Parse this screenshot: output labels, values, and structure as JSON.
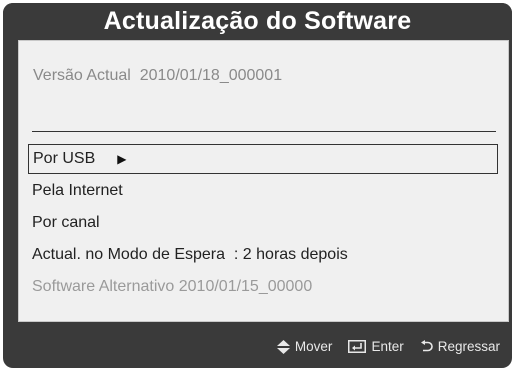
{
  "title": "Actualização do Software",
  "current_version": {
    "label": "Versão Actual",
    "value": "2010/01/18_000001"
  },
  "menu": {
    "by_usb": "Por USB",
    "by_internet": "Pela Internet",
    "by_channel": "Por canal",
    "standby": {
      "label": "Actual. no Modo de Espera",
      "value": ": 2 horas depois"
    },
    "alternative": {
      "label": "Software Alternativo",
      "value": "2010/01/15_00000"
    }
  },
  "footer": {
    "move": "Mover",
    "enter": "Enter",
    "return": "Regressar"
  },
  "icons": {
    "submenu_arrow": "play-right-icon",
    "move": "up-down-arrows-icon",
    "enter": "enter-icon",
    "return": "return-icon"
  },
  "colors": {
    "frame": "#3a3a3a",
    "panel": "#f0f0f0",
    "text": "#222222",
    "dim_text": "#9a9a9a"
  }
}
